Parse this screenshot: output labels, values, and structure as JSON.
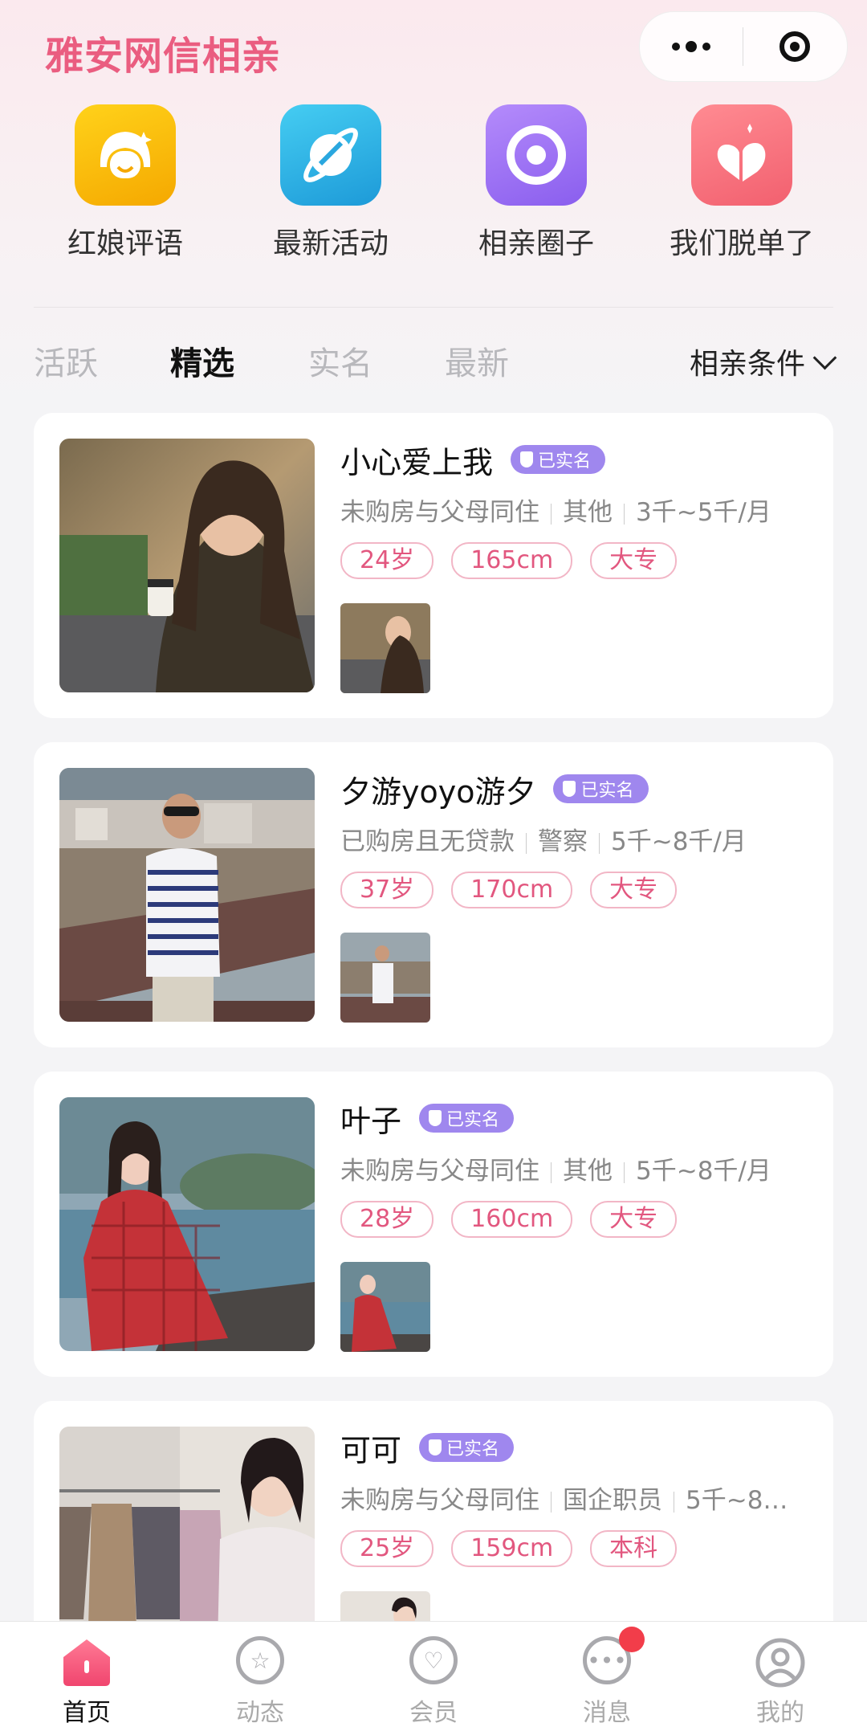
{
  "header": {
    "title": "雅安网信相亲"
  },
  "quick_links": [
    {
      "label": "红娘评语",
      "icon": "matchmaker-face-icon",
      "color": "#f7b400"
    },
    {
      "label": "最新活动",
      "icon": "planet-icon",
      "color": "#2eb4e6"
    },
    {
      "label": "相亲圈子",
      "icon": "circle-ring-icon",
      "color": "#9b72f2"
    },
    {
      "label": "我们脱单了",
      "icon": "hearts-icon",
      "color": "#f5707e"
    }
  ],
  "tabs": [
    {
      "label": "活跃",
      "active": false
    },
    {
      "label": "精选",
      "active": true
    },
    {
      "label": "实名",
      "active": false
    },
    {
      "label": "最新",
      "active": false
    }
  ],
  "filter": {
    "label": "相亲条件"
  },
  "verified_label": "已实名",
  "profiles": [
    {
      "name": "小心爱上我",
      "housing": "未购房与父母同住",
      "job": "其他",
      "income": "3千~5千/月",
      "tags": [
        "24岁",
        "165cm",
        "大专"
      ]
    },
    {
      "name": "夕游yoyo游夕",
      "housing": "已购房且无贷款",
      "job": "警察",
      "income": "5千~8千/月",
      "tags": [
        "37岁",
        "170cm",
        "大专"
      ]
    },
    {
      "name": "叶子",
      "housing": "未购房与父母同住",
      "job": "其他",
      "income": "5千~8千/月",
      "tags": [
        "28岁",
        "160cm",
        "大专"
      ]
    },
    {
      "name": "可可",
      "housing": "未购房与父母同住",
      "job": "国企职员",
      "income": "5千~8…",
      "tags": [
        "25岁",
        "159cm",
        "本科"
      ]
    }
  ],
  "tabbar": [
    {
      "label": "首页",
      "icon": "home-icon",
      "active": true
    },
    {
      "label": "动态",
      "icon": "star-icon",
      "active": false
    },
    {
      "label": "会员",
      "icon": "member-heart-icon",
      "active": false
    },
    {
      "label": "消息",
      "icon": "message-icon",
      "active": false,
      "badge": true
    },
    {
      "label": "我的",
      "icon": "profile-icon",
      "active": false
    }
  ],
  "colors": {
    "brand": "#ea5d80",
    "verified": "#9f87ee",
    "tag_text": "#e2577f"
  }
}
